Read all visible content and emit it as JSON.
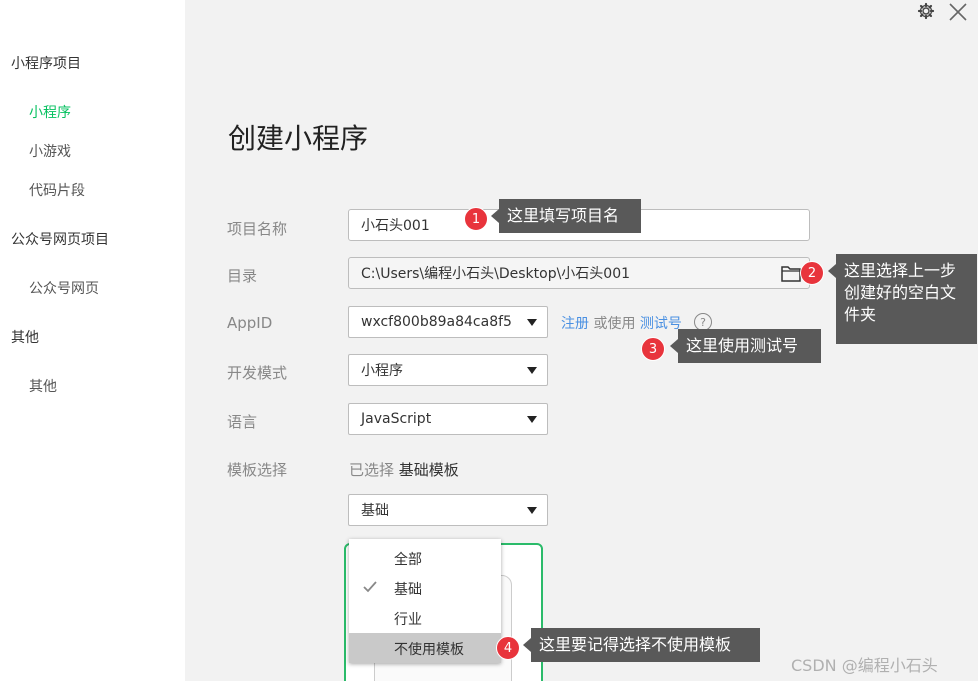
{
  "sidebar": {
    "sections": [
      {
        "title": "小程序项目",
        "items": [
          {
            "label": "小程序",
            "active": true
          },
          {
            "label": "小游戏"
          },
          {
            "label": "代码片段"
          }
        ]
      },
      {
        "title": "公众号网页项目",
        "items": [
          {
            "label": "公众号网页"
          }
        ]
      },
      {
        "title": "其他",
        "items": [
          {
            "label": "其他"
          }
        ]
      }
    ]
  },
  "header": {
    "settings_icon": "gear-icon",
    "close_icon": "close-icon"
  },
  "main": {
    "title": "创建小程序",
    "project_name": {
      "label": "项目名称",
      "value": "小石头001"
    },
    "directory": {
      "label": "目录",
      "value": "C:\\Users\\编程小石头\\Desktop\\小石头001",
      "icon": "folder-icon"
    },
    "appid": {
      "label": "AppID",
      "value": "wxcf800b89a84ca8f5",
      "register_link": "注册",
      "or_use": "或使用",
      "test_link": "测试号",
      "help": "?"
    },
    "dev_mode": {
      "label": "开发模式",
      "value": "小程序"
    },
    "language": {
      "label": "语言",
      "value": "JavaScript"
    },
    "template": {
      "label": "模板选择",
      "selected_prefix": "已选择",
      "selected_value": "基础模板",
      "filter_value": "基础"
    },
    "dropdown": {
      "options": [
        "全部",
        "基础",
        "行业",
        "不使用模板"
      ],
      "checked": "基础",
      "highlighted": "不使用模板"
    }
  },
  "annotations": [
    {
      "num": "1",
      "text": "这里填写项目名"
    },
    {
      "num": "2",
      "text": "这里选择上一步创建好的空白文件夹"
    },
    {
      "num": "3",
      "text": "这里使用测试号"
    },
    {
      "num": "4",
      "text": "这里要记得选择不使用模板"
    }
  ],
  "watermark": "CSDN @编程小石头",
  "colors": {
    "accent_green": "#07c160",
    "link_blue": "#4a90e2",
    "badge_red": "#e8343c",
    "tip_bg": "#595959"
  }
}
